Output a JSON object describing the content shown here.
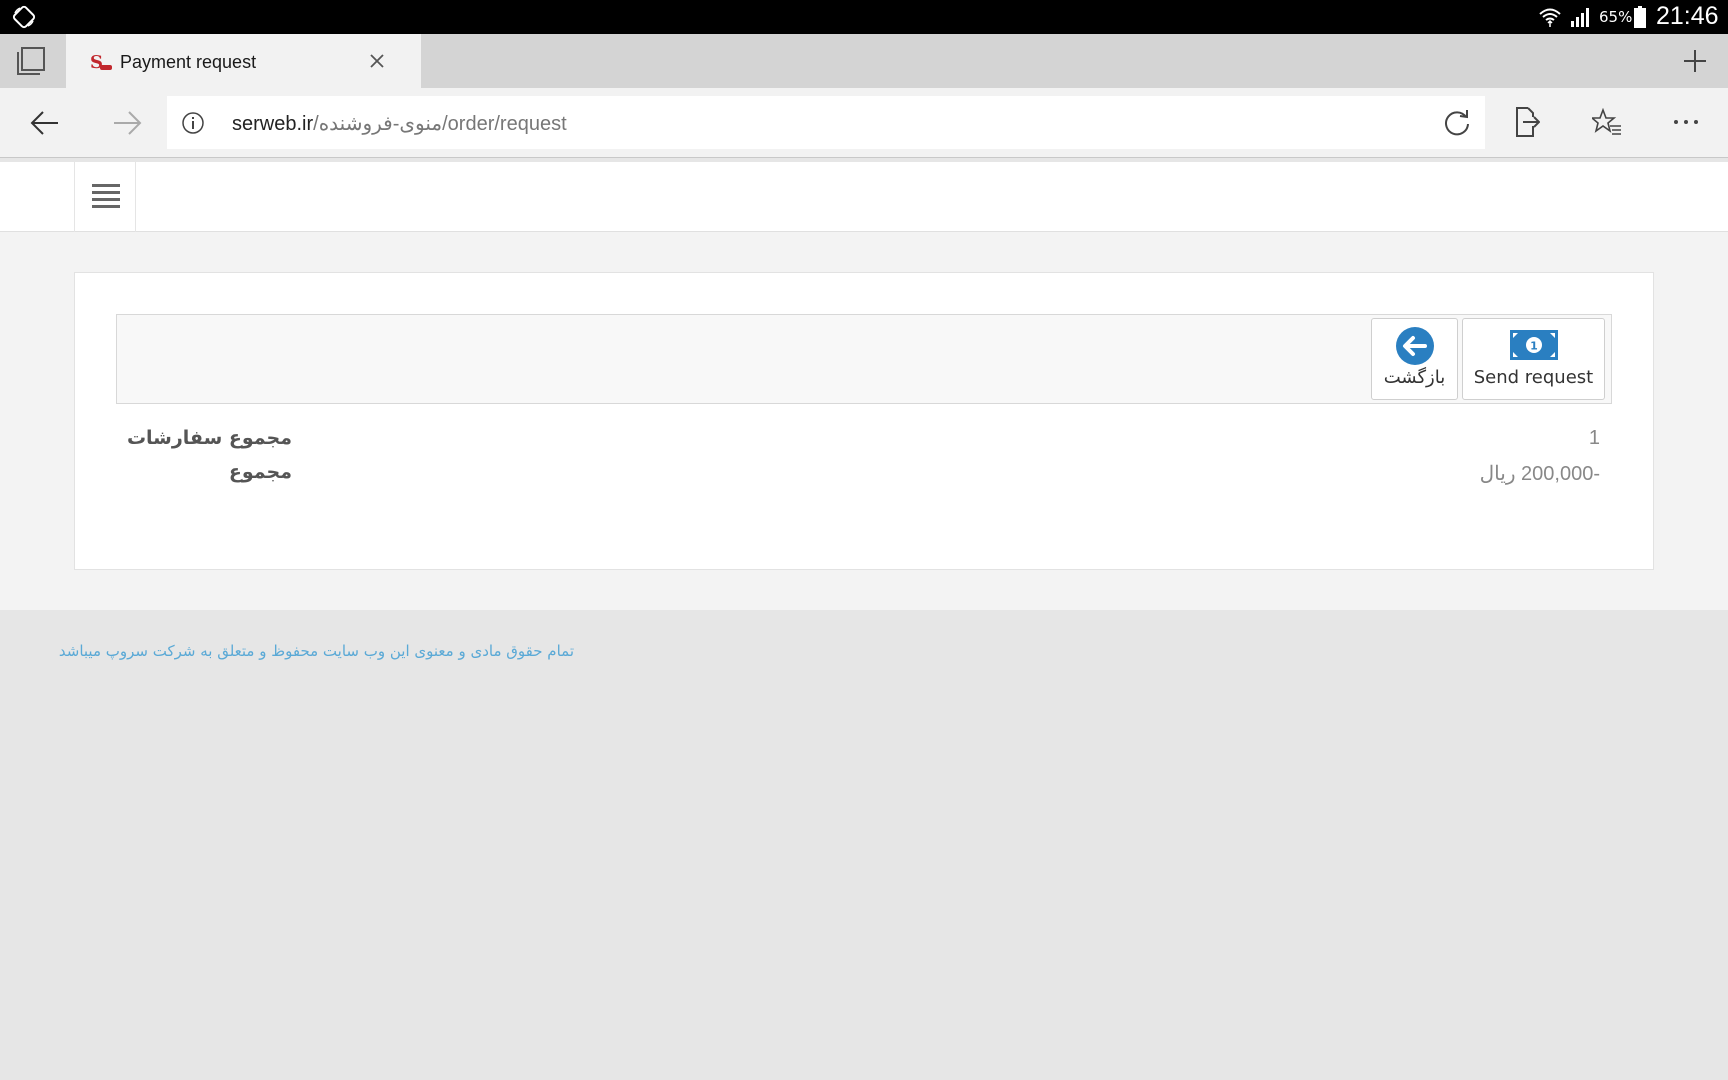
{
  "status_bar": {
    "battery_percent": "65%",
    "time": "21:46"
  },
  "browser": {
    "tab": {
      "title": "Payment request"
    },
    "address": {
      "host": "serweb.ir",
      "path": "/منوی-فروشنده/order/request"
    }
  },
  "toolbar": {
    "send_request_label": "Send request",
    "back_label": "بازگشت"
  },
  "summary": {
    "orders_total_label": "مجموع سفارشات",
    "orders_total_value": "1",
    "sum_label": "مجموع",
    "sum_value": "-200,000 ریال"
  },
  "footer": {
    "copyright": "تمام حقوق مادی و معنوی این وب سایت محفوظ و متعلق به شرکت سروپ میباشد"
  },
  "colors": {
    "accent": "#2a7fc1",
    "footer_link": "#5aa9d6",
    "favicon": "#c1272d"
  }
}
